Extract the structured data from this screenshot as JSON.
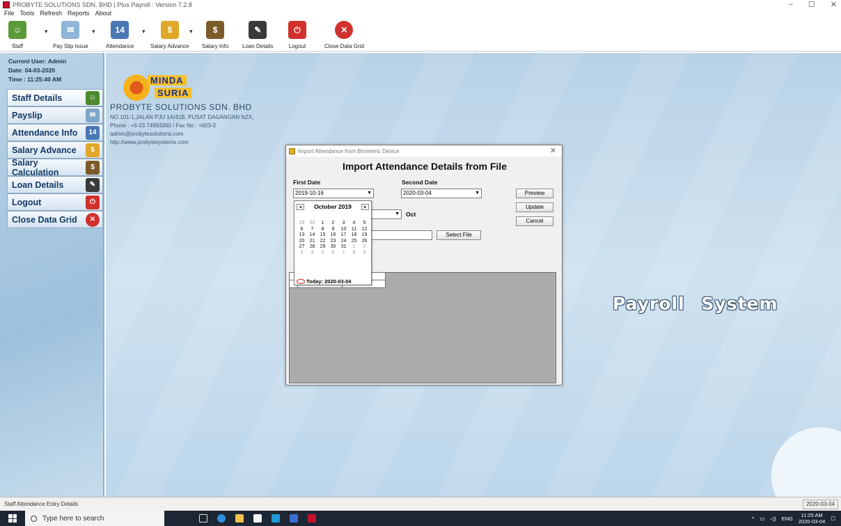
{
  "window": {
    "title": "PROBYTE SOLUTIONS SDN. BHD | Plus Payroll : Version 7.2.8",
    "controls": [
      "–",
      "☐",
      "✕"
    ]
  },
  "menu": [
    "File",
    "Tools",
    "Refresh",
    "Reports",
    "About"
  ],
  "toolbar": {
    "staff": "Staff",
    "pay_slip_issue": "Pay Slip Issue",
    "attendance": "Attendance",
    "salary_advance": "Salary Advance",
    "salary_info": "Salary Info",
    "loan_details": "Loan Details",
    "logout": "Logout",
    "close_data_grid": "Close Data Grid"
  },
  "user_info": {
    "current_user": "Current User: Admin",
    "date": "Date: 04-03-2020",
    "time": "Time : 11:25:40 AM"
  },
  "nav": [
    {
      "label": "Staff Details",
      "icon": "staff-icon",
      "color": "#4c8a2e"
    },
    {
      "label": "Payslip",
      "icon": "payslip-icon",
      "color": "#7fa6c9"
    },
    {
      "label": "Attendance Info",
      "icon": "calendar-icon",
      "color": "#4a78b4"
    },
    {
      "label": "Salary Advance",
      "icon": "salary-advance-icon",
      "color": "#e0a728"
    },
    {
      "label": "Salary Calculation",
      "icon": "money-bag-icon",
      "color": "#7b5b2a"
    },
    {
      "label": "Loan Details",
      "icon": "loan-document-icon",
      "color": "#3a3a3a"
    },
    {
      "label": "Logout",
      "icon": "power-icon",
      "color": "#d0312d"
    },
    {
      "label": "Close Data Grid",
      "icon": "close-icon",
      "color": "#d0312d"
    }
  ],
  "company": {
    "logo_line1": "MINDA",
    "logo_line2": "SURIA",
    "name": "PROBYTE SOLUTIONS  SDN. BHD",
    "address": "NO.101-1,JALAN PJU 1A/41B, PUSAT DAGANGAN NZX,",
    "phone": "Phone : +6 03 74993360 / Fax No : +603-0",
    "email": "admin@probytesolutions.com",
    "website": "http://www.probytesystems.com"
  },
  "app_title": "Payroll System",
  "dialog": {
    "title": "Import Attendance from Biometric Device",
    "heading": "Import Attendance Details from File",
    "first_date_label": "First Date",
    "first_date_value": "2019-10-16",
    "second_date_label": "Second Date",
    "second_date_value": "2020-03-04",
    "month_value": "Oct",
    "preview": "Preview",
    "update": "Update",
    "cancel": "Cancel",
    "select_file": "Select File"
  },
  "calendar": {
    "month_title": "October 2019",
    "prev": "◂",
    "next": "▸",
    "weeks": [
      [
        "29",
        "30",
        "1",
        "2",
        "3",
        "4",
        "5"
      ],
      [
        "6",
        "7",
        "8",
        "9",
        "10",
        "11",
        "12"
      ],
      [
        "13",
        "14",
        "15",
        "16",
        "17",
        "18",
        "19"
      ],
      [
        "20",
        "21",
        "22",
        "23",
        "24",
        "25",
        "26"
      ],
      [
        "27",
        "28",
        "29",
        "30",
        "31",
        "1",
        "2"
      ],
      [
        "3",
        "4",
        "5",
        "6",
        "7",
        "8",
        "9"
      ]
    ],
    "today": "Today: 2020-03-04"
  },
  "status": {
    "left": "Staff Attendance Entry Details",
    "right": "2020-03-04"
  },
  "taskbar": {
    "search_placeholder": "Type here to search",
    "time": "11:25 AM",
    "date": "2020-03-04",
    "lang": "ENG"
  }
}
